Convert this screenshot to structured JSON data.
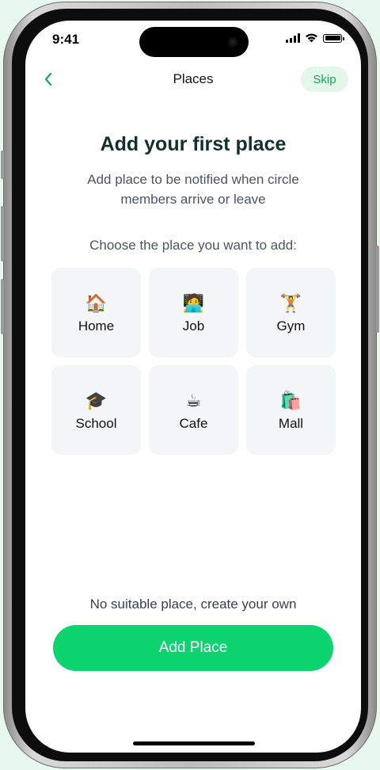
{
  "status_bar": {
    "time": "9:41"
  },
  "header": {
    "title": "Places",
    "skip_label": "Skip",
    "back_icon": "chevron-left-icon"
  },
  "main": {
    "heading": "Add your first place",
    "subtitle": "Add place to be notified when circle members arrive or leave",
    "choose_prompt": "Choose the place you want to add:",
    "places": [
      {
        "label": "Home",
        "emoji": "🏠",
        "icon": "house-icon"
      },
      {
        "label": "Job",
        "emoji": "🧑‍💻",
        "icon": "person-at-laptop-icon"
      },
      {
        "label": "Gym",
        "emoji": "🏋️",
        "icon": "weightlifter-icon"
      },
      {
        "label": "School",
        "emoji": "🎓",
        "icon": "graduation-cap-icon"
      },
      {
        "label": "Cafe",
        "emoji": "☕",
        "icon": "coffee-icon"
      },
      {
        "label": "Mall",
        "emoji": "🛍️",
        "icon": "shopping-bags-icon"
      }
    ]
  },
  "footer": {
    "hint": "No suitable place, create your own",
    "add_button_label": "Add Place"
  },
  "colors": {
    "accent": "#0cd46e",
    "skip_bg": "#e3f7ea",
    "skip_text": "#1fa35a",
    "heading": "#12312a",
    "card_bg": "#f4f5f6",
    "background": "#e7f8ef"
  }
}
